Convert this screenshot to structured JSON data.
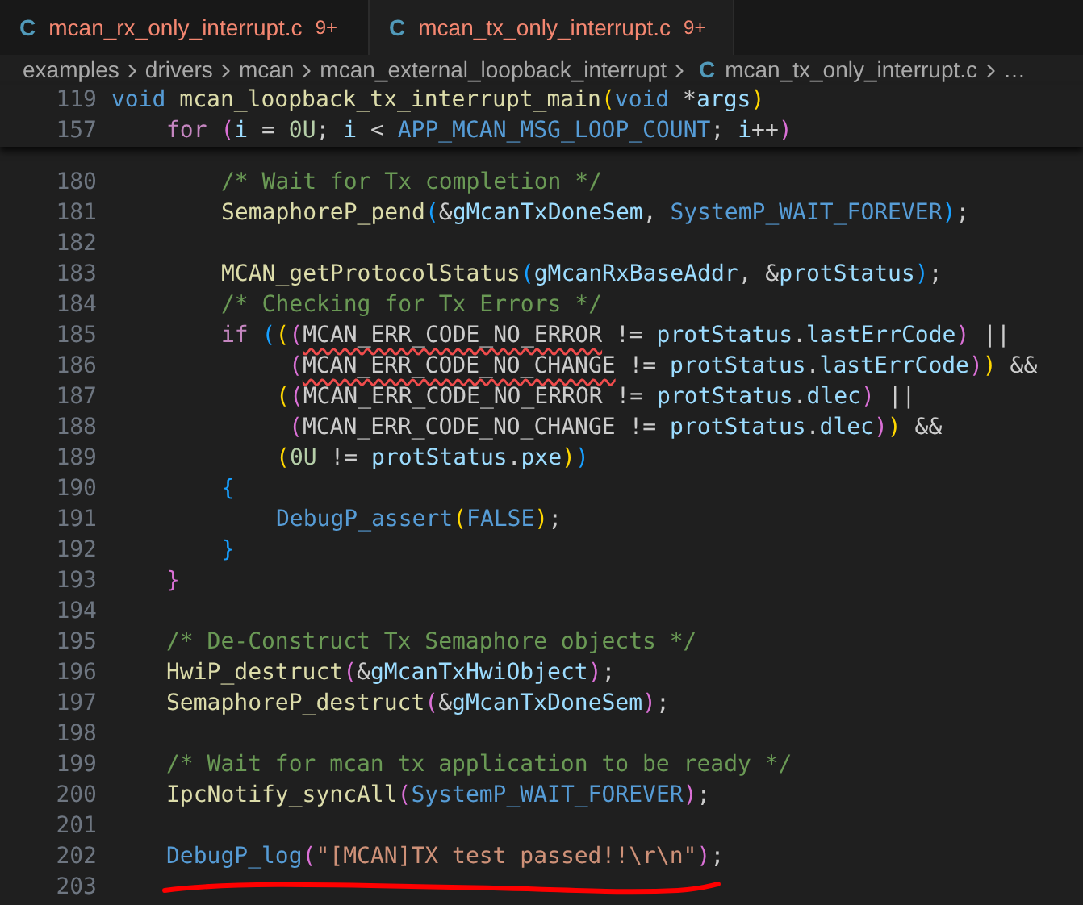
{
  "tabs": [
    {
      "icon_letter": "C",
      "label": "mcan_rx_only_interrupt.c",
      "badge": "9+",
      "selected": false
    },
    {
      "icon_letter": "C",
      "label": "mcan_tx_only_interrupt.c",
      "badge": "9+",
      "selected": true
    }
  ],
  "breadcrumb": [
    {
      "label": "examples"
    },
    {
      "label": "drivers"
    },
    {
      "label": "mcan"
    },
    {
      "label": "mcan_external_loopback_interrupt"
    },
    {
      "label": "mcan_tx_only_interrupt.c",
      "icon_letter": "C"
    },
    {
      "label": "…"
    }
  ],
  "sticky_lines": [
    {
      "number": "119",
      "kind": "outer",
      "tokens": [
        {
          "kind": "type",
          "text": "void "
        },
        {
          "kind": "fn",
          "text": "mcan_loopback_tx_interrupt_main"
        },
        {
          "kind": "b1",
          "text": "("
        },
        {
          "kind": "type",
          "text": "void "
        },
        {
          "kind": "punct",
          "text": "*"
        },
        {
          "kind": "var",
          "text": "args"
        },
        {
          "kind": "b1",
          "text": ")"
        }
      ]
    },
    {
      "number": "157",
      "kind": "loop",
      "tokens": [
        {
          "kind": "ctrl",
          "text": "for "
        },
        {
          "kind": "b2",
          "text": "("
        },
        {
          "kind": "var",
          "text": "i"
        },
        {
          "kind": "punct",
          "text": " = "
        },
        {
          "kind": "num",
          "text": "0U"
        },
        {
          "kind": "punct",
          "text": "; "
        },
        {
          "kind": "var",
          "text": "i"
        },
        {
          "kind": "punct",
          "text": " < "
        },
        {
          "kind": "macro",
          "text": "APP_MCAN_MSG_LOOP_COUNT"
        },
        {
          "kind": "punct",
          "text": "; "
        },
        {
          "kind": "var",
          "text": "i"
        },
        {
          "kind": "punct",
          "text": "++"
        },
        {
          "kind": "b2",
          "text": ")"
        }
      ]
    }
  ],
  "lines": [
    {
      "number": "180",
      "kind": "body",
      "tokens": [
        {
          "kind": "comment",
          "text": "/* Wait for Tx completion */"
        }
      ]
    },
    {
      "number": "181",
      "kind": "body",
      "tokens": [
        {
          "kind": "fn",
          "text": "SemaphoreP_pend"
        },
        {
          "kind": "b3",
          "text": "("
        },
        {
          "kind": "punct",
          "text": "&"
        },
        {
          "kind": "var",
          "text": "gMcanTxDoneSem"
        },
        {
          "kind": "punct",
          "text": ", "
        },
        {
          "kind": "macro",
          "text": "SystemP_WAIT_FOREVER"
        },
        {
          "kind": "b3",
          "text": ")"
        },
        {
          "kind": "punct",
          "text": ";"
        }
      ]
    },
    {
      "number": "182"
    },
    {
      "number": "183",
      "kind": "body",
      "tokens": [
        {
          "kind": "fn",
          "text": "MCAN_getProtocolStatus"
        },
        {
          "kind": "b3",
          "text": "("
        },
        {
          "kind": "var",
          "text": "gMcanRxBaseAddr"
        },
        {
          "kind": "punct",
          "text": ", &"
        },
        {
          "kind": "var",
          "text": "protStatus"
        },
        {
          "kind": "b3",
          "text": ")"
        },
        {
          "kind": "punct",
          "text": ";"
        }
      ]
    },
    {
      "number": "184",
      "kind": "body",
      "tokens": [
        {
          "kind": "comment",
          "text": "/* Checking for Tx Errors */"
        }
      ]
    },
    {
      "number": "185",
      "kind": "body",
      "tokens": [
        {
          "kind": "ctrl",
          "text": "if "
        },
        {
          "kind": "b3",
          "text": "("
        },
        {
          "kind": "b1",
          "text": "("
        },
        {
          "kind": "b2",
          "text": "("
        },
        {
          "kind": "plain",
          "text": "MCAN_ERR_CODE_NO_ERROR",
          "error": true
        },
        {
          "kind": "punct",
          "text": " != "
        },
        {
          "kind": "var",
          "text": "protStatus"
        },
        {
          "kind": "punct",
          "text": "."
        },
        {
          "kind": "var",
          "text": "lastErrCode"
        },
        {
          "kind": "b2",
          "text": ")"
        },
        {
          "kind": "punct",
          "text": " ||"
        }
      ]
    },
    {
      "number": "186",
      "kind": "aligned",
      "tokens": [
        {
          "kind": "b2",
          "text": "("
        },
        {
          "kind": "plain",
          "text": "MCAN_ERR_CODE_NO_CHANGE",
          "error": true
        },
        {
          "kind": "punct",
          "text": " != "
        },
        {
          "kind": "var",
          "text": "protStatus"
        },
        {
          "kind": "punct",
          "text": "."
        },
        {
          "kind": "var",
          "text": "lastErrCode"
        },
        {
          "kind": "b2",
          "text": ")"
        },
        {
          "kind": "b1",
          "text": ")"
        },
        {
          "kind": "punct",
          "text": " &&"
        }
      ]
    },
    {
      "number": "187",
      "kind": "nested",
      "tokens": [
        {
          "kind": "b1",
          "text": "("
        },
        {
          "kind": "b2",
          "text": "("
        },
        {
          "kind": "plain",
          "text": "MCAN_ERR_CODE_NO_ERROR",
          "error": false
        },
        {
          "kind": "punct",
          "text": " != "
        },
        {
          "kind": "var",
          "text": "protStatus"
        },
        {
          "kind": "punct",
          "text": "."
        },
        {
          "kind": "var",
          "text": "dlec"
        },
        {
          "kind": "b2",
          "text": ")"
        },
        {
          "kind": "punct",
          "text": " ||"
        }
      ]
    },
    {
      "number": "188",
      "kind": "aligned",
      "tokens": [
        {
          "kind": "b2",
          "text": "("
        },
        {
          "kind": "plain",
          "text": "MCAN_ERR_CODE_NO_CHANGE",
          "error": false
        },
        {
          "kind": "punct",
          "text": " != "
        },
        {
          "kind": "var",
          "text": "protStatus"
        },
        {
          "kind": "punct",
          "text": "."
        },
        {
          "kind": "var",
          "text": "dlec"
        },
        {
          "kind": "b2",
          "text": ")"
        },
        {
          "kind": "b1",
          "text": ")"
        },
        {
          "kind": "punct",
          "text": " &&"
        }
      ]
    },
    {
      "number": "189",
      "kind": "nested",
      "tokens": [
        {
          "kind": "b1",
          "text": "("
        },
        {
          "kind": "num",
          "text": "0U"
        },
        {
          "kind": "punct",
          "text": " != "
        },
        {
          "kind": "var",
          "text": "protStatus"
        },
        {
          "kind": "punct",
          "text": "."
        },
        {
          "kind": "var",
          "text": "pxe"
        },
        {
          "kind": "b1",
          "text": ")"
        },
        {
          "kind": "b3",
          "text": ")"
        }
      ]
    },
    {
      "number": "190",
      "kind": "body",
      "tokens": [
        {
          "kind": "b3",
          "text": "{"
        }
      ]
    },
    {
      "number": "191",
      "kind": "nested",
      "tokens": [
        {
          "kind": "macro",
          "text": "DebugP_assert"
        },
        {
          "kind": "b1",
          "text": "("
        },
        {
          "kind": "macro",
          "text": "FALSE"
        },
        {
          "kind": "b1",
          "text": ")"
        },
        {
          "kind": "punct",
          "text": ";"
        }
      ]
    },
    {
      "number": "192",
      "kind": "body",
      "tokens": [
        {
          "kind": "b3",
          "text": "}"
        }
      ]
    },
    {
      "number": "193",
      "kind": "loop",
      "tokens": [
        {
          "kind": "b2",
          "text": "}"
        }
      ]
    },
    {
      "number": "194"
    },
    {
      "number": "195",
      "kind": "loop",
      "tokens": [
        {
          "kind": "comment",
          "text": "/* De-Construct Tx Semaphore objects */"
        }
      ]
    },
    {
      "number": "196",
      "kind": "loop",
      "tokens": [
        {
          "kind": "fn",
          "text": "HwiP_destruct"
        },
        {
          "kind": "b2",
          "text": "("
        },
        {
          "kind": "punct",
          "text": "&"
        },
        {
          "kind": "var",
          "text": "gMcanTxHwiObject"
        },
        {
          "kind": "b2",
          "text": ")"
        },
        {
          "kind": "punct",
          "text": ";"
        }
      ]
    },
    {
      "number": "197",
      "kind": "loop",
      "tokens": [
        {
          "kind": "fn",
          "text": "SemaphoreP_destruct"
        },
        {
          "kind": "b2",
          "text": "("
        },
        {
          "kind": "punct",
          "text": "&"
        },
        {
          "kind": "var",
          "text": "gMcanTxDoneSem"
        },
        {
          "kind": "b2",
          "text": ")"
        },
        {
          "kind": "punct",
          "text": ";"
        }
      ]
    },
    {
      "number": "198"
    },
    {
      "number": "199",
      "kind": "loop",
      "tokens": [
        {
          "kind": "comment",
          "text": "/* Wait for mcan tx application to be ready */"
        }
      ]
    },
    {
      "number": "200",
      "kind": "loop",
      "tokens": [
        {
          "kind": "fn",
          "text": "IpcNotify_syncAll"
        },
        {
          "kind": "b2",
          "text": "("
        },
        {
          "kind": "macro",
          "text": "SystemP_WAIT_FOREVER"
        },
        {
          "kind": "b2",
          "text": ")"
        },
        {
          "kind": "punct",
          "text": ";"
        }
      ]
    },
    {
      "number": "201"
    },
    {
      "number": "202",
      "kind": "loop",
      "tokens": [
        {
          "kind": "macro",
          "text": "DebugP_log"
        },
        {
          "kind": "b2",
          "text": "("
        },
        {
          "kind": "string",
          "text": "\"[MCAN]TX test passed!!\\r\\n\""
        },
        {
          "kind": "b2",
          "text": ")"
        },
        {
          "kind": "punct",
          "text": ";"
        }
      ]
    },
    {
      "number": "203"
    }
  ]
}
